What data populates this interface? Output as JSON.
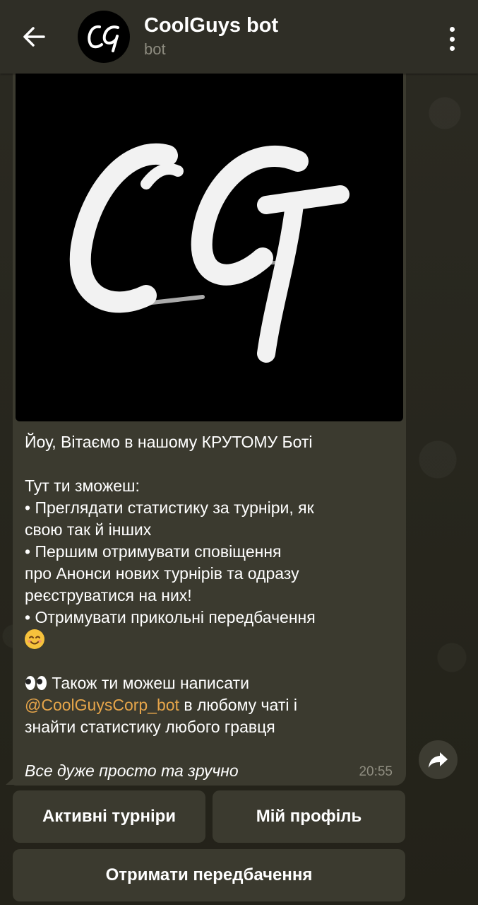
{
  "header": {
    "title": "CoolGuys bot",
    "subtitle": "bot",
    "avatar_text": "CG"
  },
  "message": {
    "photo_logo": "CG",
    "greeting": "Йоу, Вітаємо в нашому КРУТОМУ Боті",
    "intro": "Тут ти зможеш:",
    "bullet1_line1": " • Преглядати статистику за турніри, як",
    "bullet1_line2": "свою так й інших",
    "bullet2_line1": " • Першим отримувати сповіщення",
    "bullet2_line2": "про Анонси нових турнірів та одразу",
    "bullet2_line3": "реєструватися на них!",
    "bullet3_line1": " • Отримувати прикольні передбачення",
    "also_line1": " Також ти можеш написати",
    "mention": "@CoolGuysCorp_bot",
    "also_line2_rest": " в любому чаті і",
    "also_line3": "знайти статистику любого гравця",
    "closing": "Все дуже просто та зручно",
    "time": "20:55"
  },
  "keyboard": {
    "active_tournaments": "Активні турніри",
    "my_profile": "Мій профіль",
    "get_prediction": "Отримати передбачення"
  },
  "colors": {
    "header_bg": "#2f2e26",
    "bubble_bg": "#3b3a2f",
    "mention": "#e6a54a",
    "background": "#24231c"
  },
  "icons": {
    "back": "arrow-left-icon",
    "menu": "more-vertical-icon",
    "share": "share-arrow-icon"
  }
}
